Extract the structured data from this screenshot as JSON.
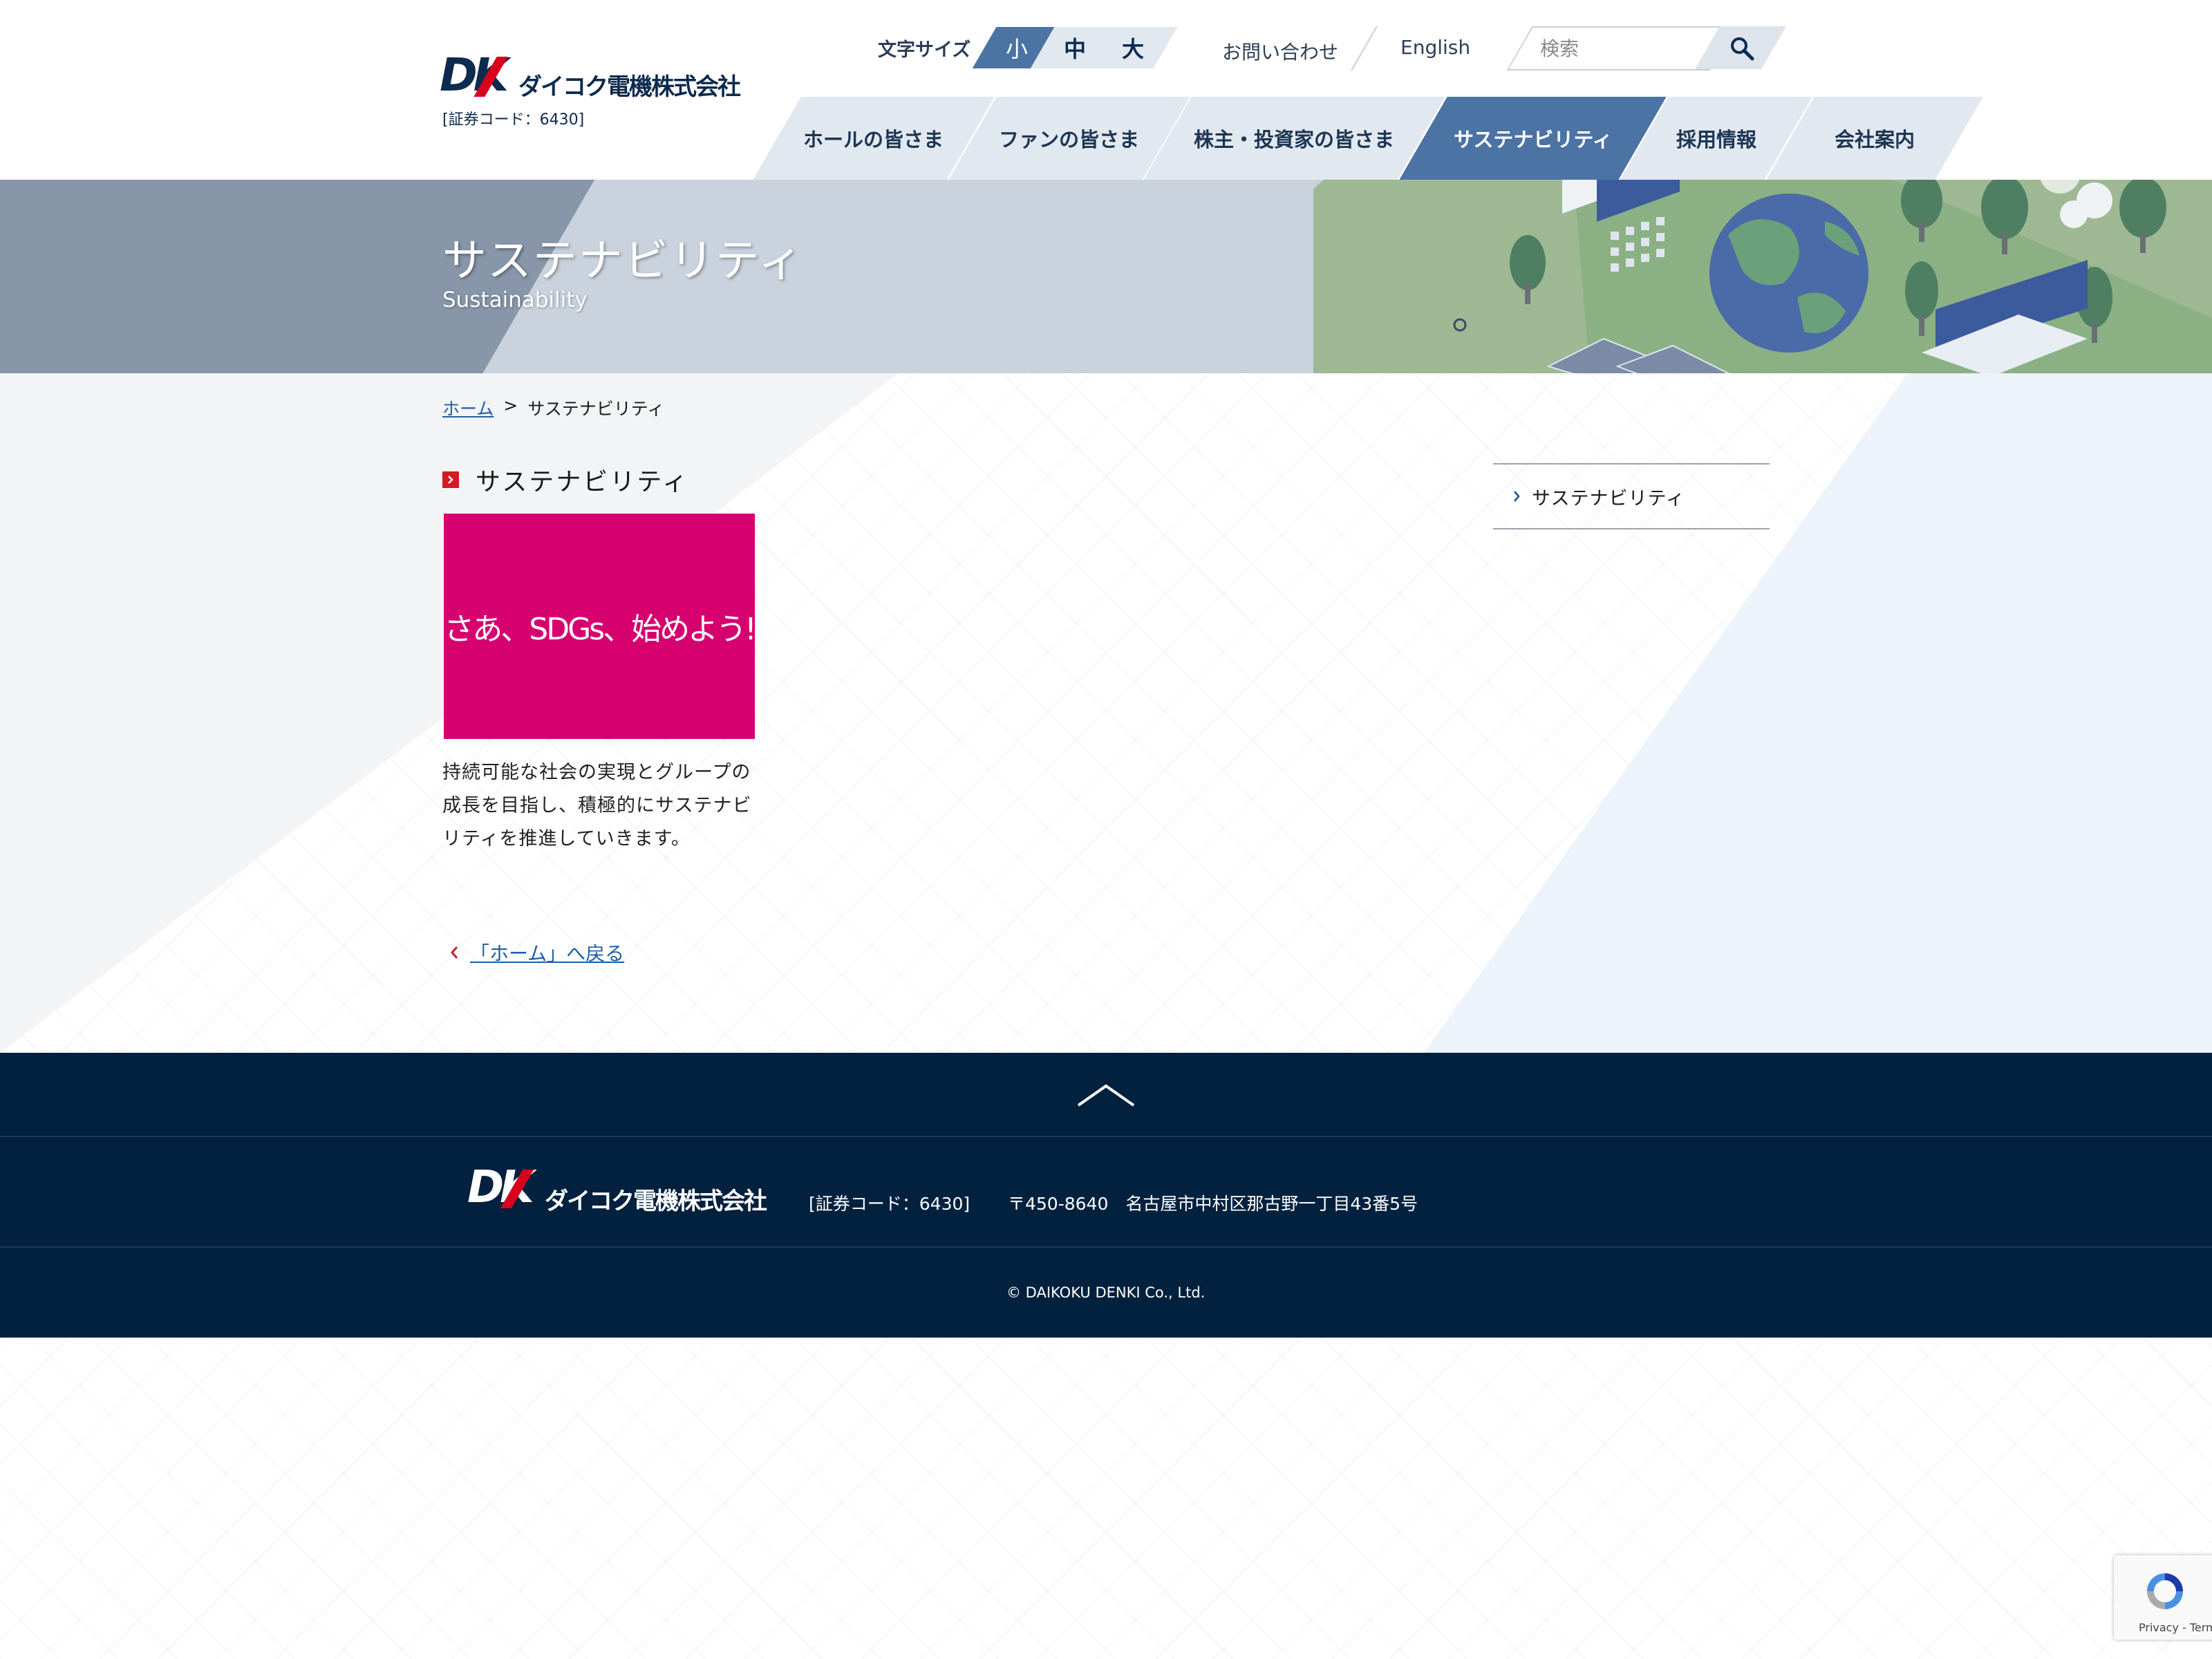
{
  "header": {
    "logo_mark": [
      "D",
      "K",
      "K"
    ],
    "company_name": "ダイコク電機株式会社",
    "stock_code": "[証券コード：6430]",
    "font_size": {
      "label": "文字サイズ",
      "options": [
        "小",
        "中",
        "大"
      ],
      "selected": "小"
    },
    "contact_label": "お問い合わせ",
    "english_label": "English",
    "search": {
      "placeholder": "検索",
      "icon": "search-icon"
    },
    "nav": [
      {
        "label": "ホールの皆さま",
        "active": false
      },
      {
        "label": "ファンの皆さま",
        "active": false
      },
      {
        "label": "株主・投資家の皆さま",
        "active": false
      },
      {
        "label": "サステナビリティ",
        "active": true
      },
      {
        "label": "採用情報",
        "active": false
      },
      {
        "label": "会社案内",
        "active": false
      }
    ]
  },
  "hero": {
    "title": "サステナビリティ",
    "subtitle": "Sustainability"
  },
  "breadcrumb": {
    "home": "ホーム",
    "separator": ">",
    "current": "サステナビリティ"
  },
  "main": {
    "heading": "サステナビリティ",
    "card_text": "さあ、SDGs、始めよう!",
    "description": "持続可能な社会の実現とグループの成長を目指し、積極的にサステナビリティを推進していきます。",
    "back_link": "「ホーム」へ戻る"
  },
  "sidebar": {
    "items": [
      {
        "label": "サステナビリティ"
      }
    ]
  },
  "footer": {
    "page_top_icon": "chevron-up-icon",
    "company_name": "ダイコク電機株式会社",
    "stock_code": "[証券コード：6430]",
    "address": "〒450-8640　名古屋市中村区那古野一丁目43番5号",
    "copyright": "© DAIKOKU DENKI Co., Ltd."
  },
  "recaptcha": {
    "links": "Privacy - Terms"
  },
  "colors": {
    "brand_navy": "#0d2a4f",
    "brand_red": "#d7001d",
    "nav_active": "#4b73a4",
    "nav_inactive": "#e1e8f0",
    "footer_bg": "#02213f",
    "sdgs_magenta": "#d6006f",
    "link_blue": "#1f5da8"
  }
}
